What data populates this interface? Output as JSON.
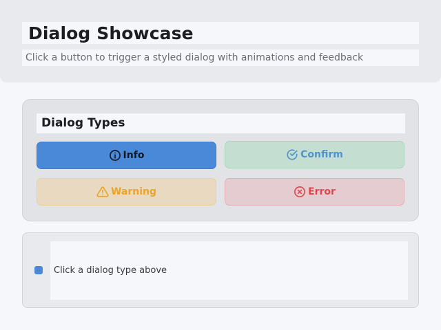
{
  "header": {
    "title": "Dialog Showcase",
    "subtitle": "Click a button to trigger a styled dialog with animations and feedback"
  },
  "panel": {
    "title": "Dialog Types",
    "buttons": [
      {
        "label": "Info",
        "icon": "info-icon"
      },
      {
        "label": "Confirm",
        "icon": "check-circle-icon"
      },
      {
        "label": "Warning",
        "icon": "warning-triangle-icon"
      },
      {
        "label": "Error",
        "icon": "error-x-icon"
      }
    ]
  },
  "status": {
    "message": "Click a dialog type above",
    "indicator_color": "#4a88d8"
  },
  "colors": {
    "info": "#4a88d8",
    "confirm": "#4f92cf",
    "warning": "#eba425",
    "error": "#e0474f"
  }
}
